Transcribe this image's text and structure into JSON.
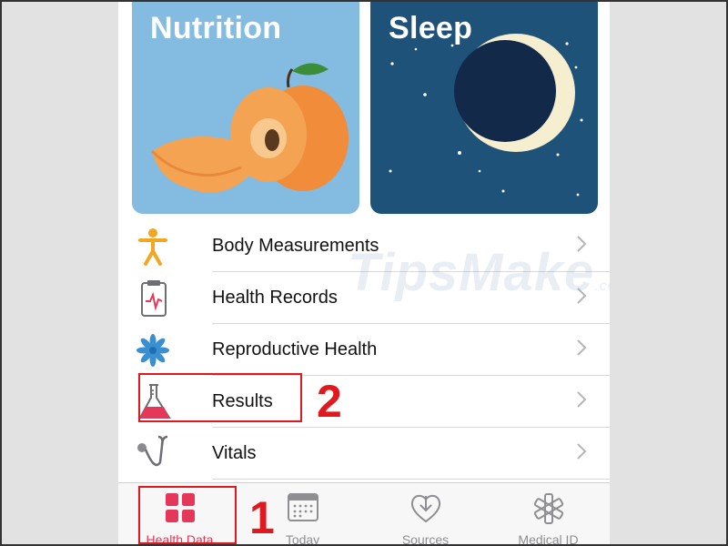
{
  "tiles": {
    "nutrition": {
      "title": "Nutrition",
      "color": "#84bbe0"
    },
    "sleep": {
      "title": "Sleep",
      "color": "#1f5278"
    }
  },
  "categories": [
    {
      "label": "Body Measurements",
      "icon": "body-figure-icon"
    },
    {
      "label": "Health Records",
      "icon": "clipboard-heartbeat-icon"
    },
    {
      "label": "Reproductive Health",
      "icon": "snowflake-flower-icon"
    },
    {
      "label": "Results",
      "icon": "flask-icon"
    },
    {
      "label": "Vitals",
      "icon": "stethoscope-icon"
    }
  ],
  "watermark": {
    "text": "TipsMake",
    "suffix": ".com"
  },
  "tabbar": {
    "tabs": [
      {
        "label": "Health Data",
        "icon": "grid-icon",
        "active": true
      },
      {
        "label": "Today",
        "icon": "calendar-icon",
        "active": false
      },
      {
        "label": "Sources",
        "icon": "download-heart-icon",
        "active": false
      },
      {
        "label": "Medical ID",
        "icon": "asterisk-icon",
        "active": false
      }
    ]
  },
  "annotations": {
    "step1": "1",
    "step2": "2"
  },
  "colors": {
    "accent": "#e5375a",
    "annotation": "#e0191f"
  }
}
